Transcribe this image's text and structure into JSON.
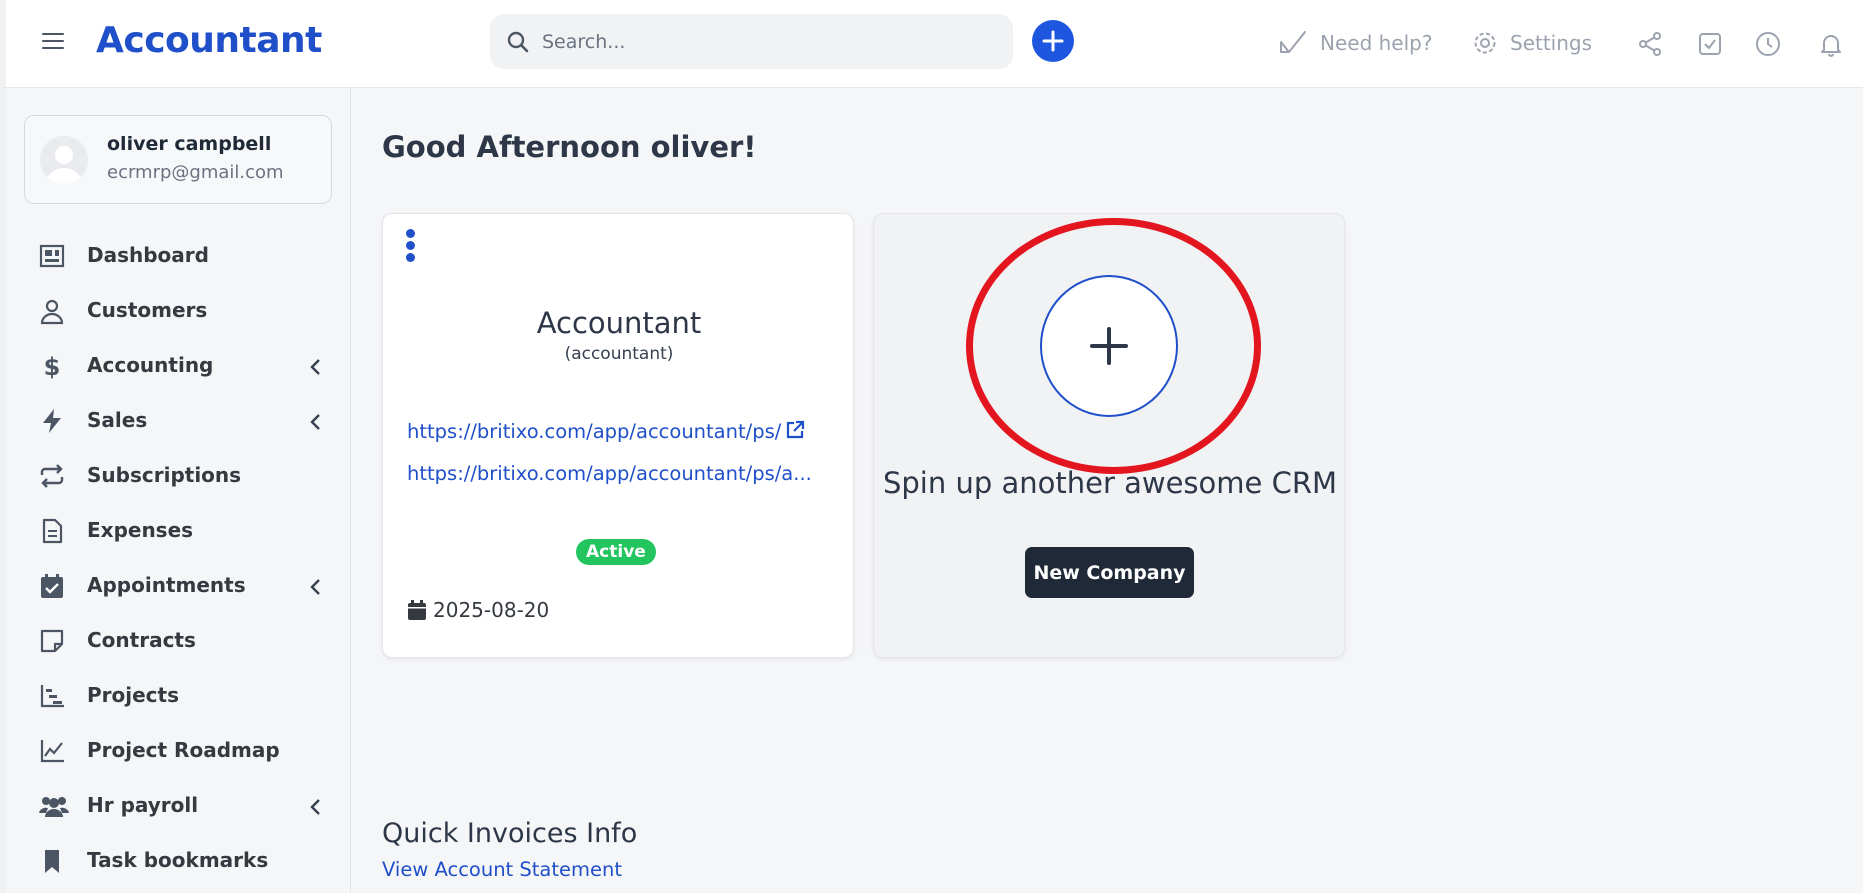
{
  "header": {
    "brand": "Accountant",
    "search_placeholder": "Search...",
    "help_label": "Need help?",
    "settings_label": "Settings"
  },
  "user": {
    "name": "oliver campbell",
    "email": "ecrmrp@gmail.com"
  },
  "sidebar": {
    "items": [
      {
        "label": "Dashboard",
        "icon": "dashboard-icon",
        "has_submenu": false
      },
      {
        "label": "Customers",
        "icon": "user-icon",
        "has_submenu": false
      },
      {
        "label": "Accounting",
        "icon": "dollar-icon",
        "has_submenu": true
      },
      {
        "label": "Sales",
        "icon": "bolt-icon",
        "has_submenu": true
      },
      {
        "label": "Subscriptions",
        "icon": "repeat-icon",
        "has_submenu": false
      },
      {
        "label": "Expenses",
        "icon": "file-icon",
        "has_submenu": false
      },
      {
        "label": "Appointments",
        "icon": "calendar-check-icon",
        "has_submenu": true
      },
      {
        "label": "Contracts",
        "icon": "sticky-note-icon",
        "has_submenu": false
      },
      {
        "label": "Projects",
        "icon": "chart-gantt-icon",
        "has_submenu": false
      },
      {
        "label": "Project Roadmap",
        "icon": "line-chart-icon",
        "has_submenu": false
      },
      {
        "label": "Hr payroll",
        "icon": "users-icon",
        "has_submenu": true
      },
      {
        "label": "Task bookmarks",
        "icon": "bookmark-icon",
        "has_submenu": false
      }
    ]
  },
  "main": {
    "greeting": "Good Afternoon oliver!",
    "company_card": {
      "name": "Accountant",
      "slug": "(accountant)",
      "link1": "https://britixo.com/app/accountant/ps/",
      "link2": "https://britixo.com/app/accountant/ps/a...",
      "status": "Active",
      "date": "2025-08-20"
    },
    "new_card": {
      "text": "Spin up another awesome CRM",
      "button": "New Company"
    },
    "quick_invoices": {
      "title": "Quick Invoices Info",
      "link": "View Account Statement"
    }
  },
  "colors": {
    "brand_blue": "#1f4fc9",
    "fab_blue": "#1f56e0",
    "active_green": "#22c55e",
    "highlight_red": "#e3161f",
    "dark_button": "#1f2937"
  }
}
